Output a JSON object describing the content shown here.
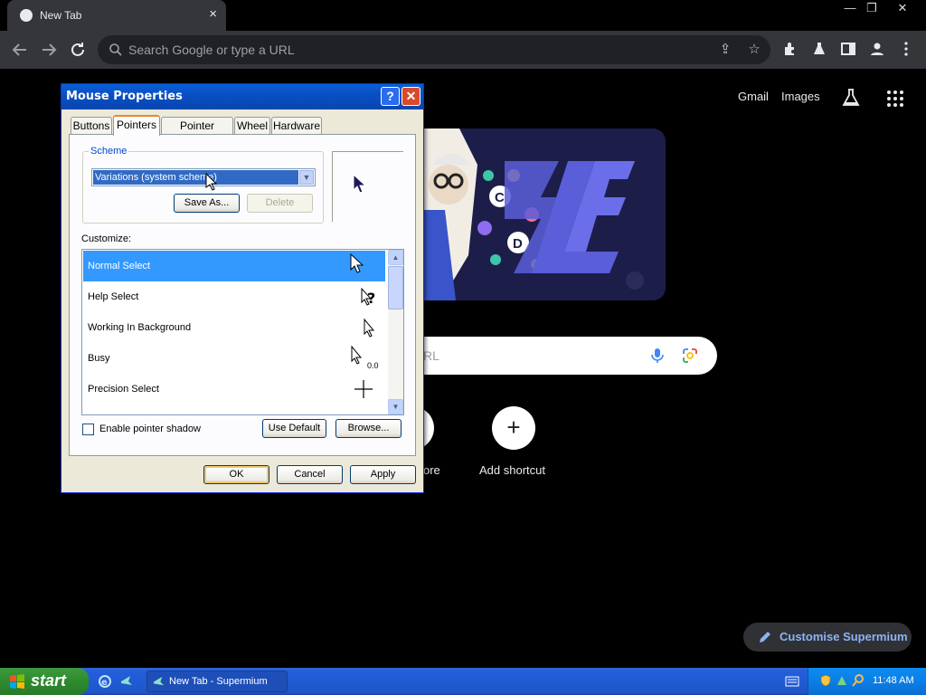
{
  "browser": {
    "tab_title": "New Tab",
    "tab_close": "×",
    "omnibox_placeholder": "Search Google or type a URL",
    "window_controls": {
      "minimize": "—",
      "restore": "❐",
      "close": "✕"
    }
  },
  "ntp": {
    "gmail": "Gmail",
    "images": "Images",
    "search_placeholder_fragment": "RL",
    "shortcut_partial_label": "ore",
    "add_shortcut_label": "Add shortcut",
    "add_symbol": "+",
    "customise_label": "Customise Supermium"
  },
  "dialog": {
    "title": "Mouse Properties",
    "help_symbol": "?",
    "close_symbol": "✕",
    "tabs": [
      {
        "label": "Buttons",
        "active": false
      },
      {
        "label": "Pointers",
        "active": true
      },
      {
        "label": "Pointer Options",
        "active": false
      },
      {
        "label": "Wheel",
        "active": false
      },
      {
        "label": "Hardware",
        "active": false
      }
    ],
    "scheme_label": "Scheme",
    "scheme_value": "Variations (system scheme)",
    "save_as_label": "Save As...",
    "delete_label": "Delete",
    "customize_label": "Customize:",
    "pointer_list": [
      {
        "label": "Normal Select",
        "selected": true,
        "cursor": "arrow"
      },
      {
        "label": "Help Select",
        "selected": false,
        "cursor": "help"
      },
      {
        "label": "Working In Background",
        "selected": false,
        "cursor": "arrow-small"
      },
      {
        "label": "Busy",
        "selected": false,
        "cursor": "busy"
      },
      {
        "label": "Precision Select",
        "selected": false,
        "cursor": "cross"
      }
    ],
    "busy_glyph": "0.0",
    "enable_shadow_label": "Enable pointer shadow",
    "enable_shadow_checked": false,
    "use_default_label": "Use Default",
    "browse_label": "Browse...",
    "ok_label": "OK",
    "cancel_label": "Cancel",
    "apply_label": "Apply"
  },
  "taskbar": {
    "start_label": "start",
    "task_label": "New Tab - Supermium",
    "clock": "11:48 AM"
  },
  "colors": {
    "xp_blue": "#0a5fd6",
    "selection": "#3399ff",
    "link_accent": "#8ab4f8"
  }
}
